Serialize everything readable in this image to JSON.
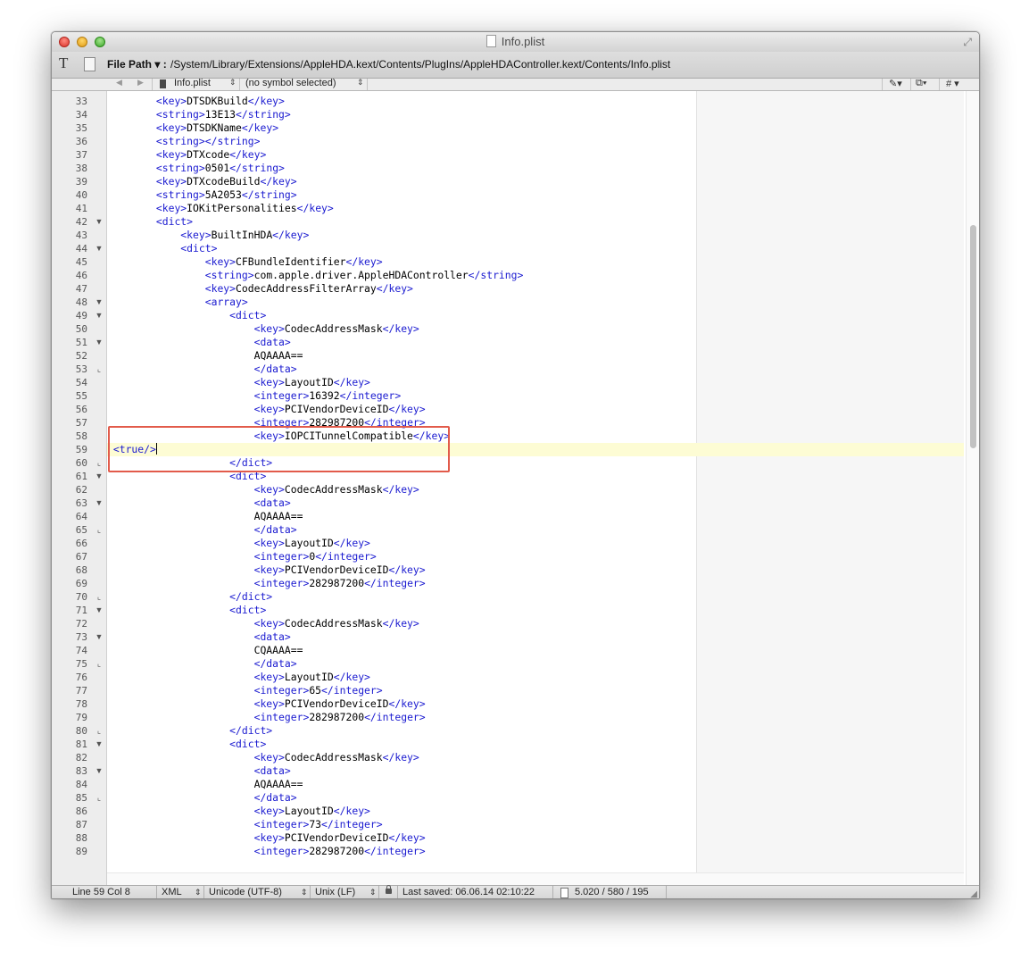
{
  "window": {
    "title": "Info.plist"
  },
  "toolbar": {
    "text_tool_icon": "T",
    "file_path_label": "File Path ▾ :",
    "file_path_value": "/System/Library/Extensions/AppleHDA.kext/Contents/PlugIns/AppleHDAController.kext/Contents/Info.plist"
  },
  "navbar": {
    "file_name": "Info.plist",
    "symbol": "(no symbol selected)",
    "hash_label": "#"
  },
  "editor": {
    "lines": [
      {
        "num": "33",
        "fold": "",
        "text": "        <key>DTSDKBuild</key>"
      },
      {
        "num": "34",
        "fold": "",
        "text": "        <string>13E13</string>"
      },
      {
        "num": "35",
        "fold": "",
        "text": "        <key>DTSDKName</key>"
      },
      {
        "num": "36",
        "fold": "",
        "text": "        <string></string>"
      },
      {
        "num": "37",
        "fold": "",
        "text": "        <key>DTXcode</key>"
      },
      {
        "num": "38",
        "fold": "",
        "text": "        <string>0501</string>"
      },
      {
        "num": "39",
        "fold": "",
        "text": "        <key>DTXcodeBuild</key>"
      },
      {
        "num": "40",
        "fold": "",
        "text": "        <string>5A2053</string>"
      },
      {
        "num": "41",
        "fold": "",
        "text": "        <key>IOKitPersonalities</key>"
      },
      {
        "num": "42",
        "fold": "open",
        "text": "        <dict>"
      },
      {
        "num": "43",
        "fold": "",
        "text": "            <key>BuiltInHDA</key>"
      },
      {
        "num": "44",
        "fold": "open",
        "text": "            <dict>"
      },
      {
        "num": "45",
        "fold": "",
        "text": "                <key>CFBundleIdentifier</key>"
      },
      {
        "num": "46",
        "fold": "",
        "text": "                <string>com.apple.driver.AppleHDAController</string>"
      },
      {
        "num": "47",
        "fold": "",
        "text": "                <key>CodecAddressFilterArray</key>"
      },
      {
        "num": "48",
        "fold": "open",
        "text": "                <array>"
      },
      {
        "num": "49",
        "fold": "open",
        "text": "                    <dict>"
      },
      {
        "num": "50",
        "fold": "",
        "text": "                        <key>CodecAddressMask</key>"
      },
      {
        "num": "51",
        "fold": "open",
        "text": "                        <data>"
      },
      {
        "num": "52",
        "fold": "",
        "text": "                        AQAAAA=="
      },
      {
        "num": "53",
        "fold": "end",
        "text": "                        </data>"
      },
      {
        "num": "54",
        "fold": "",
        "text": "                        <key>LayoutID</key>"
      },
      {
        "num": "55",
        "fold": "",
        "text": "                        <integer>16392</integer>"
      },
      {
        "num": "56",
        "fold": "",
        "text": "                        <key>PCIVendorDeviceID</key>"
      },
      {
        "num": "57",
        "fold": "",
        "text": "                        <integer>282987200</integer>"
      },
      {
        "num": "58",
        "fold": "",
        "text": "                        <key>IOPCITunnelCompatible</key>"
      },
      {
        "num": "59",
        "fold": "",
        "text": " <true/>"
      },
      {
        "num": "60",
        "fold": "end",
        "text": "                    </dict>"
      },
      {
        "num": "61",
        "fold": "open",
        "text": "                    <dict>"
      },
      {
        "num": "62",
        "fold": "",
        "text": "                        <key>CodecAddressMask</key>"
      },
      {
        "num": "63",
        "fold": "open",
        "text": "                        <data>"
      },
      {
        "num": "64",
        "fold": "",
        "text": "                        AQAAAA=="
      },
      {
        "num": "65",
        "fold": "end",
        "text": "                        </data>"
      },
      {
        "num": "66",
        "fold": "",
        "text": "                        <key>LayoutID</key>"
      },
      {
        "num": "67",
        "fold": "",
        "text": "                        <integer>0</integer>"
      },
      {
        "num": "68",
        "fold": "",
        "text": "                        <key>PCIVendorDeviceID</key>"
      },
      {
        "num": "69",
        "fold": "",
        "text": "                        <integer>282987200</integer>"
      },
      {
        "num": "70",
        "fold": "end",
        "text": "                    </dict>"
      },
      {
        "num": "71",
        "fold": "open",
        "text": "                    <dict>"
      },
      {
        "num": "72",
        "fold": "",
        "text": "                        <key>CodecAddressMask</key>"
      },
      {
        "num": "73",
        "fold": "open",
        "text": "                        <data>"
      },
      {
        "num": "74",
        "fold": "",
        "text": "                        CQAAAA=="
      },
      {
        "num": "75",
        "fold": "end",
        "text": "                        </data>"
      },
      {
        "num": "76",
        "fold": "",
        "text": "                        <key>LayoutID</key>"
      },
      {
        "num": "77",
        "fold": "",
        "text": "                        <integer>65</integer>"
      },
      {
        "num": "78",
        "fold": "",
        "text": "                        <key>PCIVendorDeviceID</key>"
      },
      {
        "num": "79",
        "fold": "",
        "text": "                        <integer>282987200</integer>"
      },
      {
        "num": "80",
        "fold": "end",
        "text": "                    </dict>"
      },
      {
        "num": "81",
        "fold": "open",
        "text": "                    <dict>"
      },
      {
        "num": "82",
        "fold": "",
        "text": "                        <key>CodecAddressMask</key>"
      },
      {
        "num": "83",
        "fold": "open",
        "text": "                        <data>"
      },
      {
        "num": "84",
        "fold": "",
        "text": "                        AQAAAA=="
      },
      {
        "num": "85",
        "fold": "end",
        "text": "                        </data>"
      },
      {
        "num": "86",
        "fold": "",
        "text": "                        <key>LayoutID</key>"
      },
      {
        "num": "87",
        "fold": "",
        "text": "                        <integer>73</integer>"
      },
      {
        "num": "88",
        "fold": "",
        "text": "                        <key>PCIVendorDeviceID</key>"
      },
      {
        "num": "89",
        "fold": "",
        "text": "                        <integer>282987200</integer>"
      }
    ],
    "current_line": "59",
    "annotation_color": "#e25b4b",
    "tag_color": "#1a1ad0",
    "current_line_color": "#fdfcd4"
  },
  "status": {
    "position": "Line 59 Col 8",
    "syntax": "XML",
    "encoding": "Unicode (UTF-8)",
    "line_endings": "Unix (LF)",
    "last_saved": "Last saved: 06.06.14 02:10:22",
    "counts": "5.020 / 580 / 195"
  },
  "icons": {
    "close": "close-icon",
    "minimize": "minimize-icon",
    "zoom": "zoom-icon",
    "fullscreen": "fullscreen-icon",
    "text_tool": "text-tool-icon",
    "document": "document-icon",
    "lock": "lock-icon",
    "pen": "pen-icon",
    "copy": "copy-icon"
  }
}
